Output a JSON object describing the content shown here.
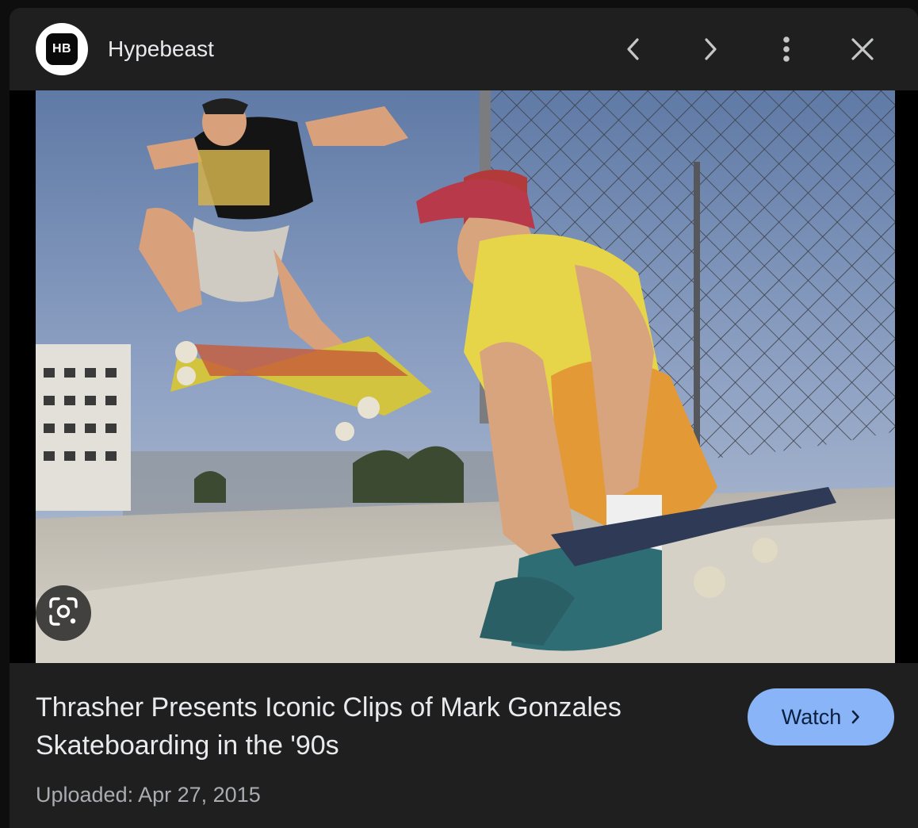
{
  "header": {
    "logo_text": "HB",
    "source_name": "Hypebeast",
    "icons": [
      "chevron-left-icon",
      "chevron-right-icon",
      "more-vert-icon",
      "close-icon"
    ]
  },
  "image": {
    "icons": [
      "lens-icon"
    ]
  },
  "footer": {
    "title": "Thrasher Presents Iconic Clips of Mark Gonzales Skateboarding in the '90s",
    "uploaded": "Uploaded: Apr 27, 2015",
    "watch_label": "Watch"
  },
  "colors": {
    "panel_bg": "#1f1f1f",
    "text_primary": "#e8eaed",
    "text_secondary": "#a9acb1",
    "accent": "#8ab4f8"
  }
}
